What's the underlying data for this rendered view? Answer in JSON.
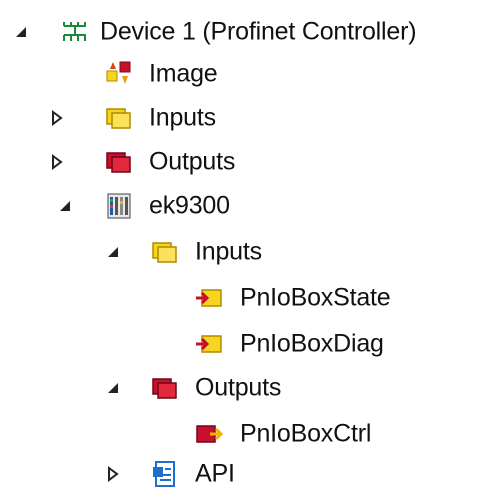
{
  "tree": {
    "root": {
      "label": "Device 1 (Profinet Controller)",
      "icon": "network-device-icon",
      "expanded": true
    },
    "image": {
      "label": "Image",
      "icon": "image-transfer-icon"
    },
    "inputs": {
      "label": "Inputs",
      "icon": "yellow-folder-icon",
      "expanded": false
    },
    "outputs": {
      "label": "Outputs",
      "icon": "red-folder-icon",
      "expanded": false
    },
    "ek9300": {
      "label": "ek9300",
      "icon": "terminal-module-icon",
      "expanded": true,
      "inputs": {
        "label": "Inputs",
        "icon": "yellow-folder-icon",
        "expanded": true
      },
      "pnio_box_state": {
        "label": "PnIoBoxState",
        "icon": "input-variable-icon"
      },
      "pnio_box_diag": {
        "label": "PnIoBoxDiag",
        "icon": "input-variable-icon"
      },
      "outputs": {
        "label": "Outputs",
        "icon": "red-folder-icon",
        "expanded": true
      },
      "pnio_box_ctrl": {
        "label": "PnIoBoxCtrl",
        "icon": "output-variable-icon"
      }
    },
    "api": {
      "label": "API",
      "icon": "api-document-icon",
      "expanded": false
    }
  },
  "colors": {
    "yellow_folder": "#f7d51d",
    "red_folder": "#c8102e",
    "input_var": "#f0b400",
    "output_var": "#c8102e",
    "api_blue": "#1f6fd1"
  }
}
